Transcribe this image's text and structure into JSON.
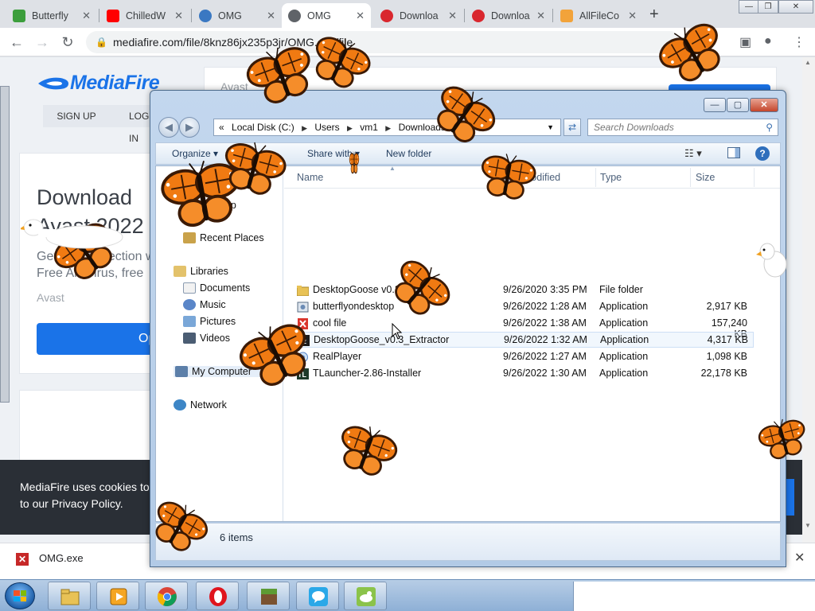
{
  "browser": {
    "tabs": [
      {
        "label": "Butterfly",
        "icon": "download-arrow-icon",
        "active": false
      },
      {
        "label": "ChilledW",
        "icon": "youtube-icon",
        "active": false
      },
      {
        "label": "OMG",
        "icon": "cloud-icon",
        "active": false
      },
      {
        "label": "OMG",
        "icon": "globe-icon",
        "active": true
      },
      {
        "label": "Downloa",
        "icon": "mega-icon",
        "active": false
      },
      {
        "label": "Downloa",
        "icon": "mega-icon",
        "active": false
      },
      {
        "label": "AllFileCo",
        "icon": "folder-icon",
        "active": false
      }
    ],
    "close_glyph": "✕",
    "new_tab": "+",
    "url": "mediafire.com/file/8knz86jx235p3jr/OMG.exe/file",
    "win_min": "—",
    "win_max": "❐",
    "win_close": "✕"
  },
  "page": {
    "logo": "MediaFire",
    "signup": "SIGN UP",
    "login": "LOG IN",
    "download_title": "Download Avast 2022",
    "download_sub_1": "Get free protection with",
    "download_sub_2": "Free Antivirus, free",
    "avast_label": "Avast",
    "open_button": "Open",
    "ad_text": "Avast",
    "cookie_line_1": "MediaFire uses cookies to provide you with the best experience.",
    "cookie_line_2": "to our Privacy Policy."
  },
  "download_bar": {
    "filename": "OMG.exe",
    "close": "✕"
  },
  "explorer": {
    "address": {
      "prefix": "«",
      "segments": [
        "Local Disk (C:)",
        "Users",
        "vm1",
        "Downloads"
      ],
      "separator": "▶"
    },
    "search_placeholder": "Search Downloads",
    "toolbar": {
      "organize": "Organize ▾",
      "share": "Share with ▾",
      "new_folder": "New folder"
    },
    "columns": {
      "name": "Name",
      "date": "Date modified",
      "type": "Type",
      "size": "Size"
    },
    "nav": [
      {
        "label": "Desktop",
        "icon": "desktop-icon"
      },
      {
        "label": "Recent Places",
        "icon": "recent-places-icon"
      },
      {
        "label": "Libraries",
        "icon": "libraries-icon"
      },
      {
        "label": "Documents",
        "icon": "documents-icon"
      },
      {
        "label": "Music",
        "icon": "music-icon"
      },
      {
        "label": "Pictures",
        "icon": "pictures-icon"
      },
      {
        "label": "Videos",
        "icon": "videos-icon"
      },
      {
        "label": "My Computer",
        "icon": "computer-icon"
      },
      {
        "label": "Network",
        "icon": "network-icon"
      }
    ],
    "files": [
      {
        "name": "DesktopGoose v0.3",
        "date": "9/26/2020 3:35 PM",
        "type": "File folder",
        "size": "",
        "icon": "folder-icon"
      },
      {
        "name": "butterflyondesktop",
        "date": "9/26/2022 1:28 AM",
        "type": "Application",
        "size": "2,917 KB",
        "icon": "installer-icon"
      },
      {
        "name": "cool file",
        "date": "9/26/2022 1:38 AM",
        "type": "Application",
        "size": "157,240 KB",
        "icon": "red-x-app-icon"
      },
      {
        "name": "DesktopGoose_v0.3_Extractor",
        "date": "9/26/2022 1:32 AM",
        "type": "Application",
        "size": "4,317 KB",
        "icon": "7zip-icon"
      },
      {
        "name": "RealPlayer",
        "date": "9/26/2022 1:27 AM",
        "type": "Application",
        "size": "1,098 KB",
        "icon": "realplayer-icon"
      },
      {
        "name": "TLauncher-2.86-Installer",
        "date": "9/26/2022 1:30 AM",
        "type": "Application",
        "size": "22,178 KB",
        "icon": "tlauncher-icon"
      }
    ],
    "status": "6 items"
  },
  "taskbar": {
    "items": [
      {
        "icon": "explorer-icon"
      },
      {
        "icon": "media-player-icon"
      },
      {
        "icon": "chrome-icon"
      },
      {
        "icon": "opera-icon"
      },
      {
        "icon": "minecraft-icon"
      },
      {
        "icon": "chat-bubble-icon"
      },
      {
        "icon": "goose-icon"
      }
    ]
  },
  "colors": {
    "accent": "#1a73e8",
    "butterfly": "#f07a12",
    "butterfly_veins": "#3b1a05"
  }
}
